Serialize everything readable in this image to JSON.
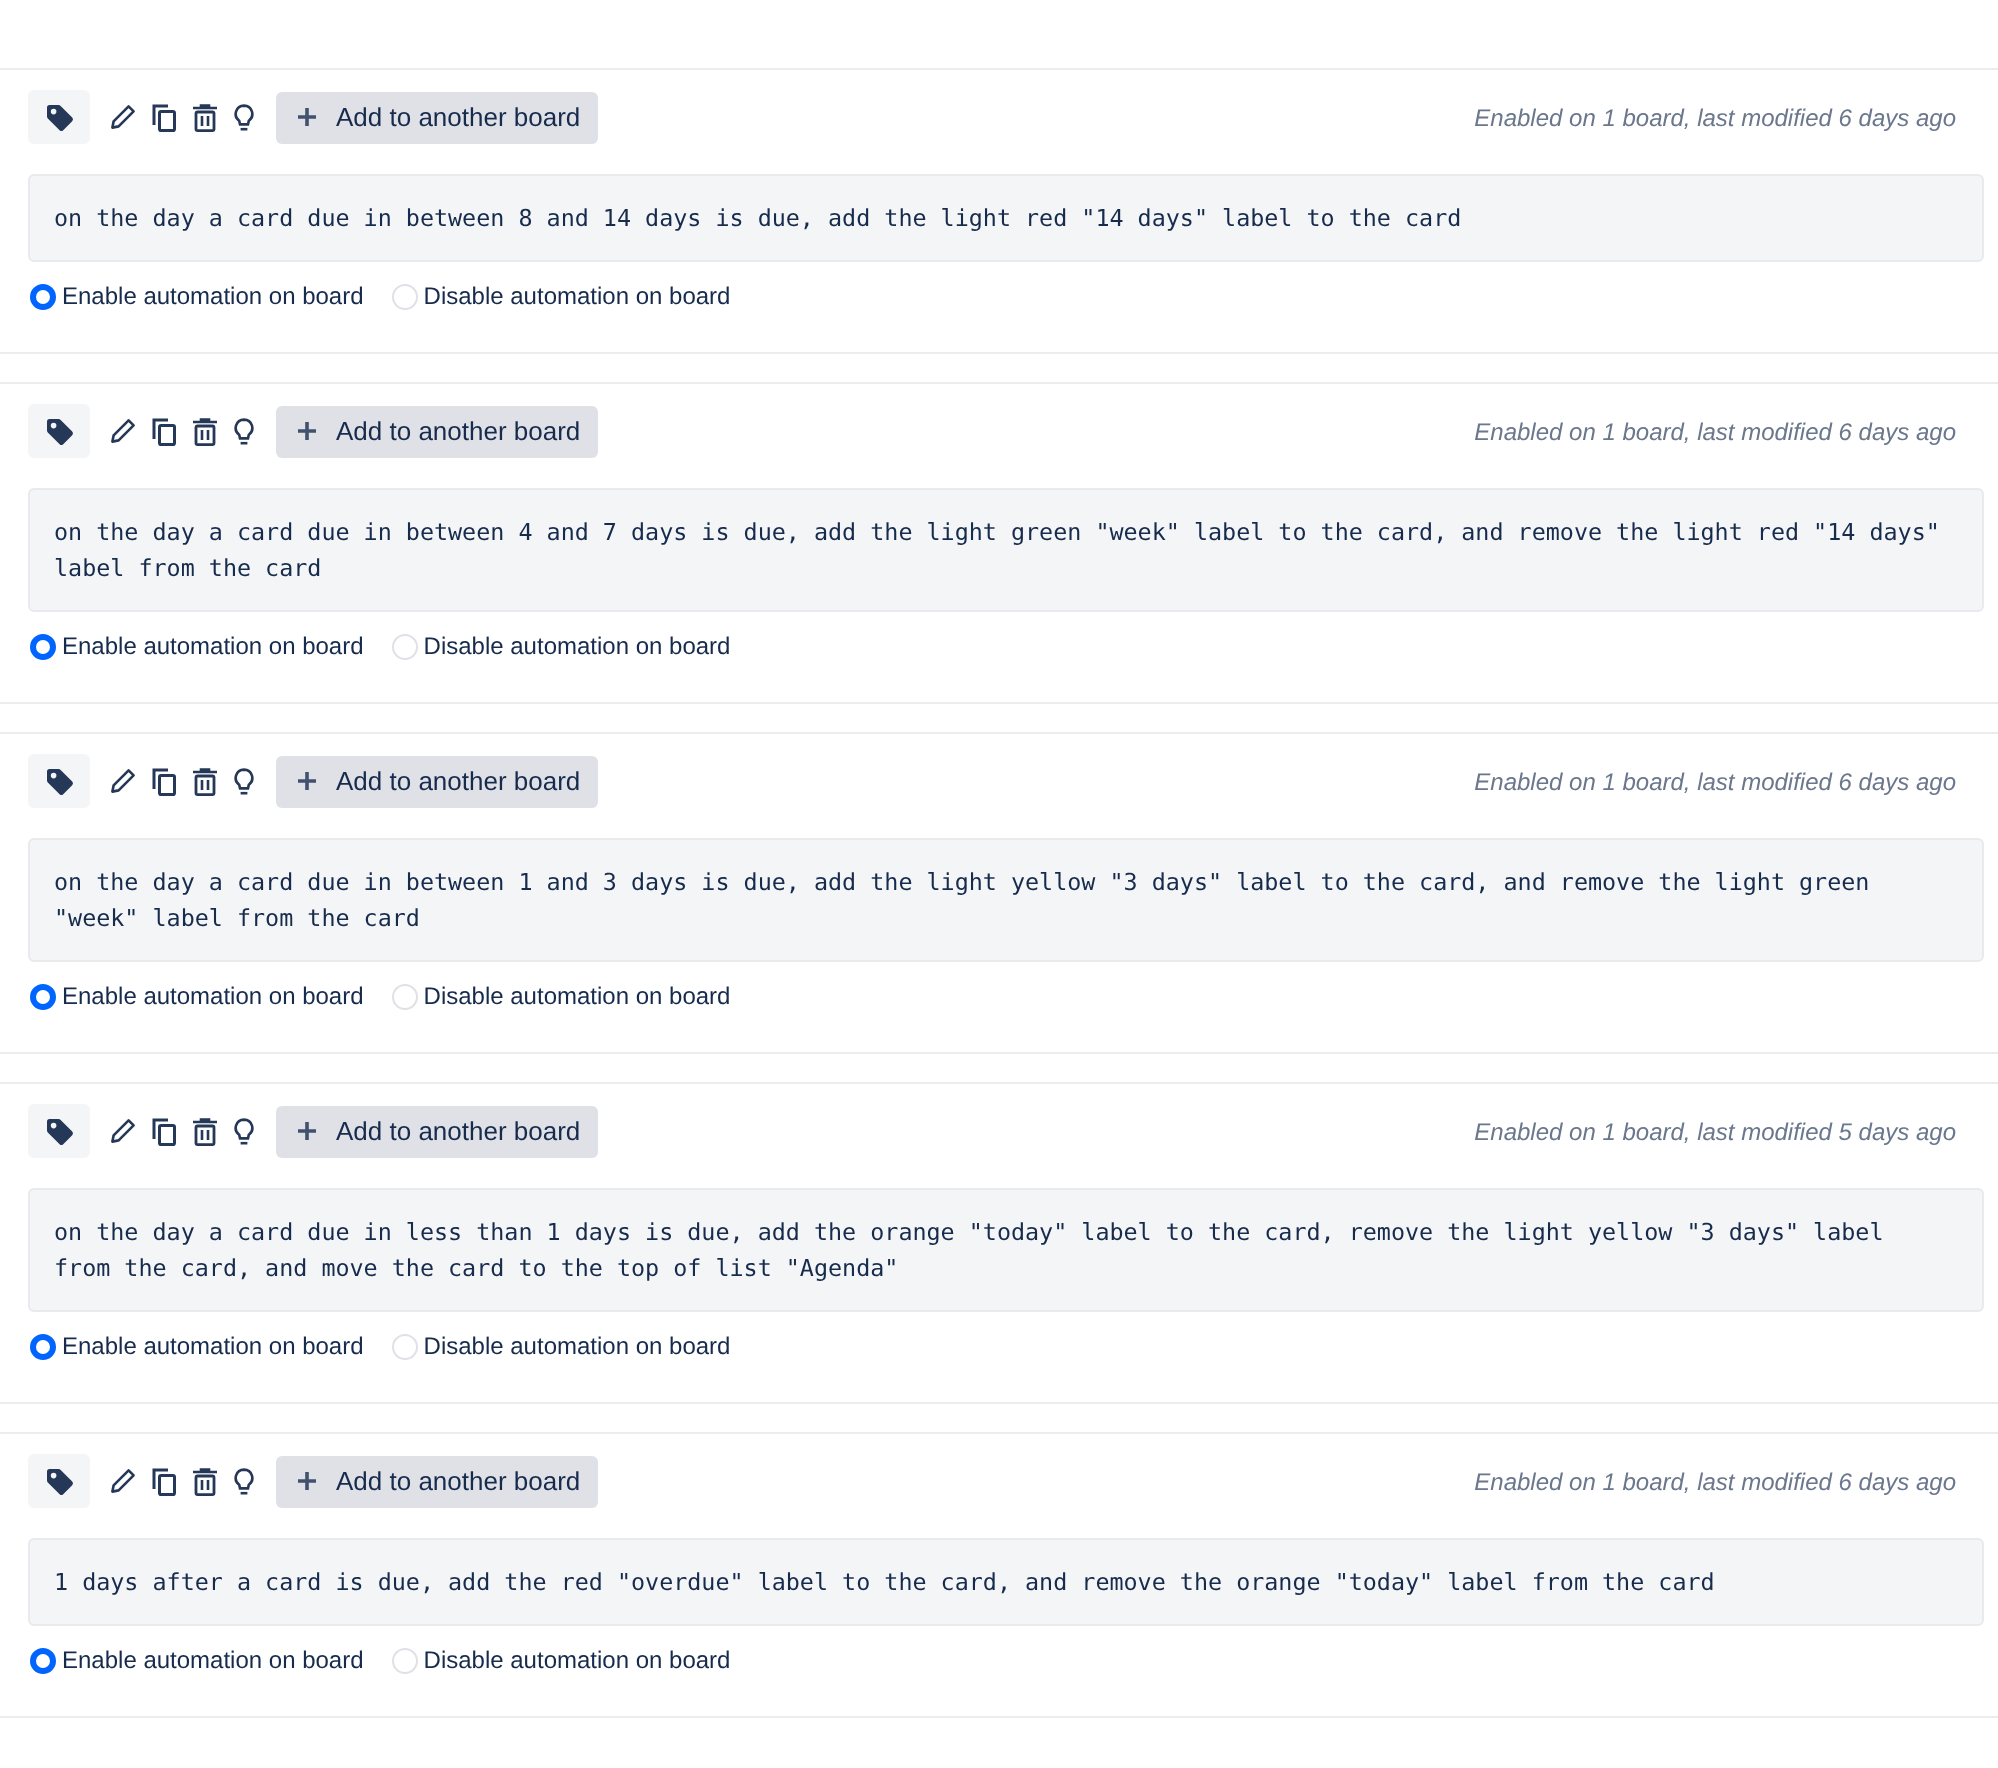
{
  "rules": [
    {
      "button": "Add to another board",
      "meta": "Enabled on 1 board, last modified 6 days ago",
      "description": "on the day a card due in between 8 and 14 days is due, add the light red \"14 days\" label to the card",
      "options": [
        {
          "label": "Enable automation on board",
          "selected": true
        },
        {
          "label": "Disable automation on board",
          "selected": false
        }
      ]
    },
    {
      "button": "Add to another board",
      "meta": "Enabled on 1 board, last modified 6 days ago",
      "description": "on the day a card due in between 4 and 7 days is due, add the light green \"week\" label to the card, and remove the light red \"14 days\" label from the card",
      "options": [
        {
          "label": "Enable automation on board",
          "selected": true
        },
        {
          "label": "Disable automation on board",
          "selected": false
        }
      ]
    },
    {
      "button": "Add to another board",
      "meta": "Enabled on 1 board, last modified 6 days ago",
      "description": "on the day a card due in between 1 and 3 days is due, add the light yellow \"3 days\" label to the card, and remove the light green \"week\" label from the card",
      "options": [
        {
          "label": "Enable automation on board",
          "selected": true
        },
        {
          "label": "Disable automation on board",
          "selected": false
        }
      ]
    },
    {
      "button": "Add to another board",
      "meta": "Enabled on 1 board, last modified 5 days ago",
      "description": "on the day a card due in less than 1 days is due, add the orange \"today\" label to the card, remove the light yellow \"3 days\" label from the card, and move the card to the top of list \"Agenda\"",
      "options": [
        {
          "label": "Enable automation on board",
          "selected": true
        },
        {
          "label": "Disable automation on board",
          "selected": false
        }
      ]
    },
    {
      "button": "Add to another board",
      "meta": "Enabled on 1 board, last modified 6 days ago",
      "description": "1 days after a card is due, add the red \"overdue\" label to the card, and remove the orange \"today\" label from the card",
      "options": [
        {
          "label": "Enable automation on board",
          "selected": true
        },
        {
          "label": "Disable automation on board",
          "selected": false
        }
      ]
    }
  ]
}
